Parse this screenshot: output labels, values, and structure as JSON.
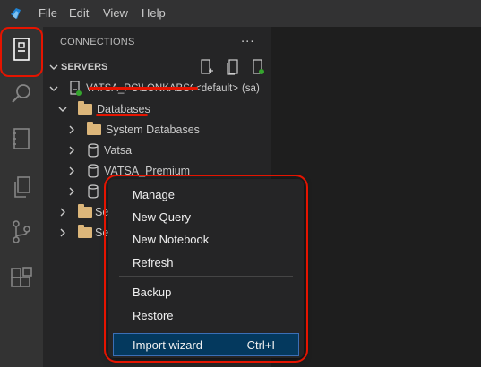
{
  "menubar": [
    "File",
    "Edit",
    "View",
    "Help"
  ],
  "sidebar": {
    "title": "CONNECTIONS",
    "more": "...",
    "section": "SERVERS",
    "server": {
      "name": "VATSA_PC\\LONKABSQL",
      "default": "<default>",
      "auth": "(sa)"
    },
    "databases_label": "Databases",
    "db_items": [
      "System Databases",
      "Vatsa",
      "VATSA_Premium"
    ],
    "trunc_items": [
      "Se",
      "Se"
    ]
  },
  "context_menu": {
    "items": [
      {
        "label": "Manage",
        "shortcut": ""
      },
      {
        "label": "New Query",
        "shortcut": ""
      },
      {
        "label": "New Notebook",
        "shortcut": ""
      },
      {
        "label": "Refresh",
        "shortcut": ""
      },
      {
        "label": "Backup",
        "shortcut": ""
      },
      {
        "label": "Restore",
        "shortcut": ""
      },
      {
        "label": "Import wizard",
        "shortcut": "Ctrl+I"
      }
    ]
  },
  "colors": {
    "highlight_red": "#e51400",
    "selection": "#04395e",
    "folder": "#dcb67a",
    "connected_dot": "#35a62e"
  },
  "icons": [
    "azure-data-studio-logo-icon",
    "connections-icon",
    "search-icon",
    "notebook-icon",
    "copy-icon",
    "source-control-icon",
    "extensions-icon",
    "new-connection-icon",
    "new-server-group-icon",
    "active-connections-icon",
    "server-icon",
    "database-icon",
    "folder-icon",
    "chevron-icon"
  ]
}
